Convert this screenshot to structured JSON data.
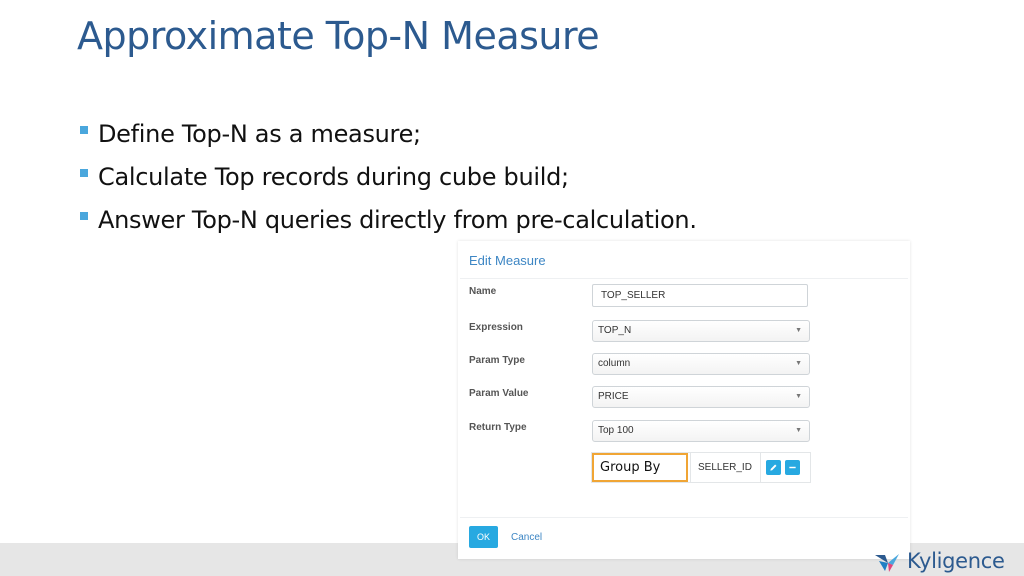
{
  "slide": {
    "title": "Approximate Top-N Measure",
    "bullets": [
      "Define Top-N as a measure;",
      "Calculate Top records during cube build;",
      "Answer Top-N queries directly from pre-calculation."
    ]
  },
  "dialog": {
    "title": "Edit Measure",
    "fields": {
      "name": {
        "label": "Name",
        "value": "TOP_SELLER"
      },
      "expression": {
        "label": "Expression",
        "value": "TOP_N"
      },
      "param_type": {
        "label": "Param Type",
        "value": "column"
      },
      "param_value": {
        "label": "Param Value",
        "value": "PRICE"
      },
      "return_type": {
        "label": "Return Type",
        "value": "Top 100"
      }
    },
    "group_by": {
      "label": "Group By",
      "value": "SELLER_ID"
    },
    "ok_label": "OK",
    "cancel_label": "Cancel"
  },
  "brand": {
    "name": "Kyligence"
  },
  "colors": {
    "title": "#2c5a8f",
    "bullet": "#4aa7dd",
    "accent": "#27a9e1",
    "highlight": "#f0a535"
  },
  "icons": {
    "edit": "pencil-icon",
    "remove": "minus-icon",
    "dropdown": "caret-down-icon"
  }
}
